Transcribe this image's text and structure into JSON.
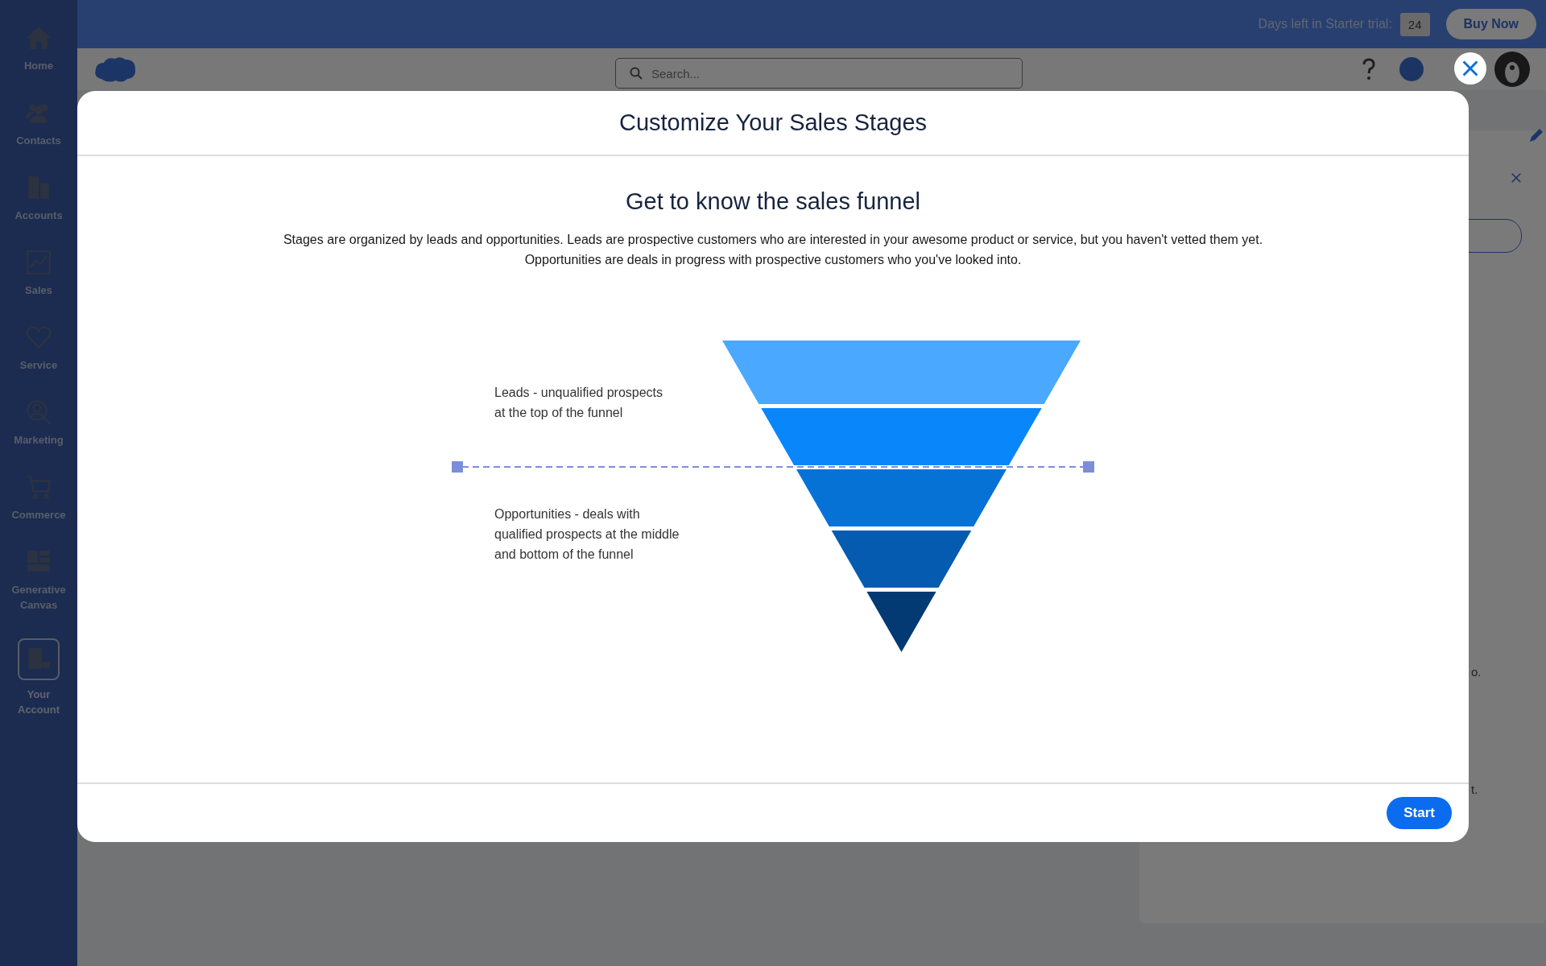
{
  "top_bar": {
    "trial_label": "Days left in Starter trial:",
    "trial_days": "24",
    "buy_button": "Buy Now"
  },
  "sidebar": {
    "items": [
      {
        "label": "Home",
        "kind": "home",
        "selected": false
      },
      {
        "label": "Contacts",
        "kind": "contacts",
        "selected": false
      },
      {
        "label": "Accounts",
        "kind": "accounts",
        "selected": false
      },
      {
        "label": "Sales",
        "kind": "sales",
        "selected": false
      },
      {
        "label": "Service",
        "kind": "service",
        "selected": false
      },
      {
        "label": "Marketing",
        "kind": "marketing",
        "selected": false
      },
      {
        "label": "Commerce",
        "kind": "commerce",
        "selected": false
      },
      {
        "label": "Generative Canvas",
        "kind": "canvas",
        "selected": false
      },
      {
        "label": "Your Account",
        "kind": "account",
        "selected": true
      }
    ]
  },
  "header": {
    "search_placeholder": "Search..."
  },
  "background_panel": {
    "fragments": [
      "o.",
      "t."
    ]
  },
  "modal": {
    "title": "Customize Your Sales Stages",
    "heading": "Get to know the sales funnel",
    "description": [
      "Stages are organized by leads and opportunities. Leads are prospective customers who are interested in your awesome product or service, but you haven't vetted them yet.",
      "Opportunities are deals in progress with prospective customers who you've looked into."
    ],
    "stages": [
      {
        "lines": [
          "Leads - unqualified prospects",
          "at the top of the funnel"
        ]
      },
      {
        "lines": [
          "Opportunities - deals with",
          "qualified prospects at the middle",
          "and bottom of the funnel"
        ]
      }
    ],
    "funnel": [
      {
        "color": "#4aa8ff"
      },
      {
        "color": "#0a86fb"
      },
      {
        "color": "#0672d6"
      },
      {
        "color": "#045bb0"
      },
      {
        "color": "#033a73"
      }
    ],
    "start_button": "Start"
  }
}
